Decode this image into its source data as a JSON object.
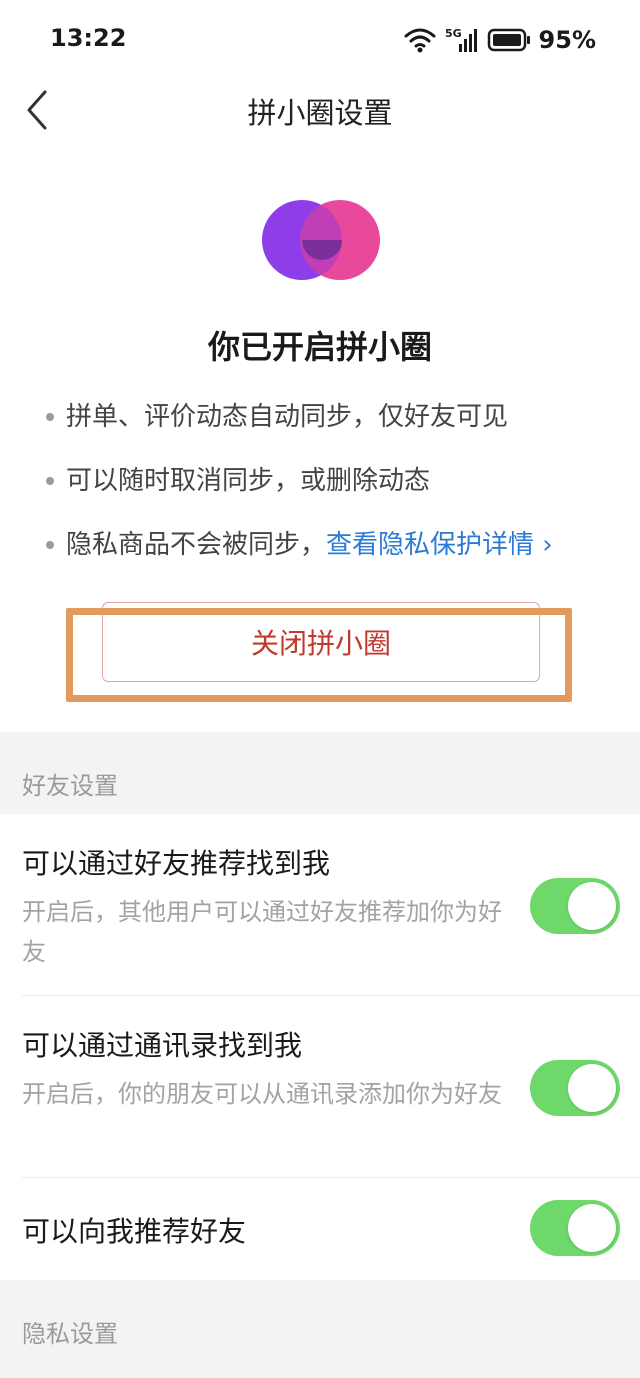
{
  "status_bar": {
    "time": "13:22",
    "battery": "95%",
    "icons": [
      "wifi-icon",
      "signal-5g-icon",
      "battery-icon"
    ]
  },
  "nav": {
    "title": "拼小圈设置",
    "back_icon": "chevron-left-icon"
  },
  "hero": {
    "logo_colors": {
      "left": "#8e3ee8",
      "right": "#e9499a",
      "overlap": "#7b2f9a"
    },
    "heading": "你已开启拼小圈",
    "bullets": [
      {
        "text": "拼单、评价动态自动同步，仅好友可见"
      },
      {
        "text": "可以随时取消同步，或删除动态"
      },
      {
        "text": "隐私商品不会被同步，",
        "link": "查看隐私保护详情 ›"
      }
    ],
    "close_button": "关闭拼小圈"
  },
  "friend_settings": {
    "header": "好友设置",
    "items": [
      {
        "title": "可以通过好友推荐找到我",
        "desc": "开启后，其他用户可以通过好友推荐加你为好友",
        "enabled": true
      },
      {
        "title": "可以通过通讯录找到我",
        "desc": "开启后，你的朋友可以从通讯录添加你为好友",
        "enabled": true
      },
      {
        "title": "可以向我推荐好友",
        "desc": "",
        "enabled": true
      }
    ]
  },
  "privacy_settings": {
    "header": "隐私设置"
  },
  "colors": {
    "accent_link": "#2b7bd6",
    "danger": "#c0392b",
    "toggle_on": "#6ed86b",
    "highlight": "#e39a5d"
  }
}
